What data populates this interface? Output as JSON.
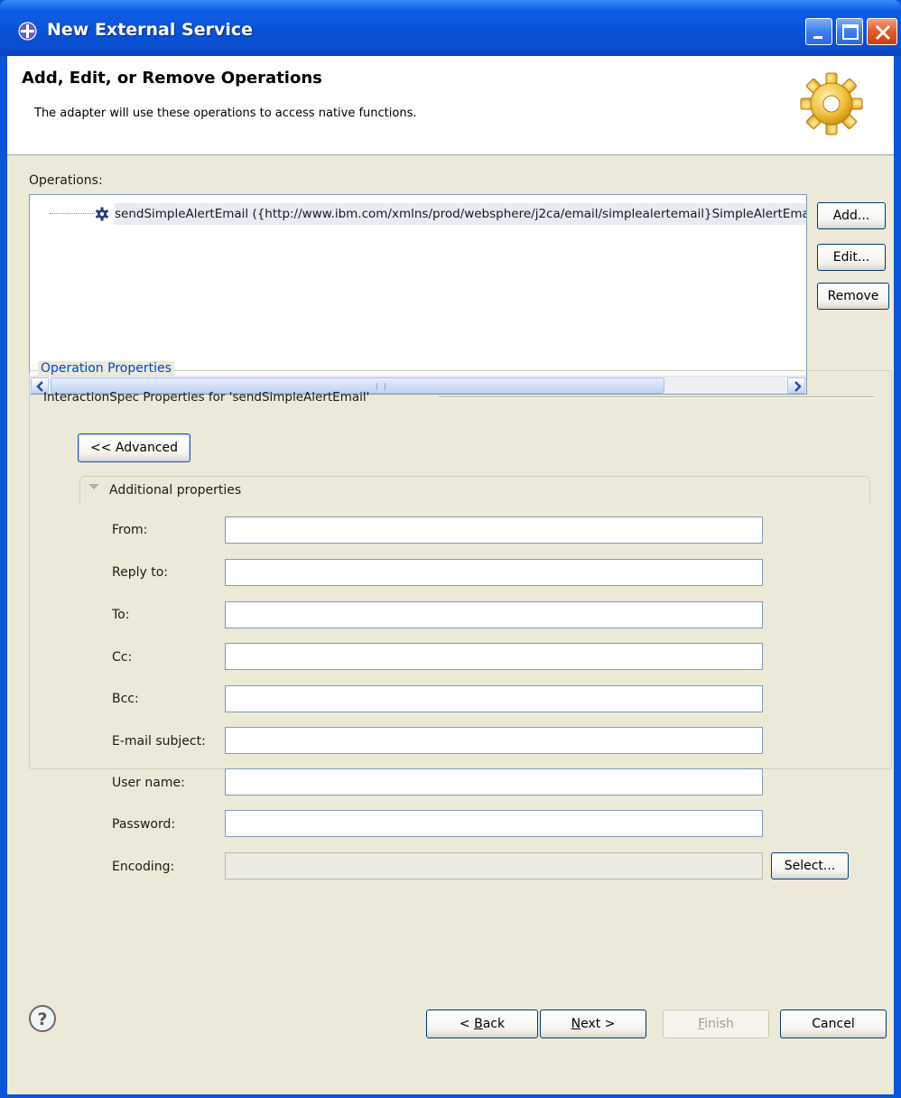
{
  "window": {
    "title": "New External Service"
  },
  "header": {
    "title": "Add, Edit, or Remove Operations",
    "description": "The adapter will use these operations to access native functions."
  },
  "operations": {
    "label": "Operations:",
    "items": [
      {
        "text": "sendSimpleAlertEmail ({http://www.ibm.com/xmlns/prod/websphere/j2ca/email/simplealertemail}SimpleAlertEmail)"
      }
    ],
    "buttons": {
      "add": "Add...",
      "edit": "Edit...",
      "remove": "Remove"
    }
  },
  "operation_properties": {
    "legend": "Operation Properties",
    "interaction_spec_label": "InteractionSpec Properties for 'sendSimpleAlertEmail'",
    "advanced_button": "<< Advanced",
    "additional_label": "Additional properties",
    "fields": [
      {
        "label": "From:",
        "value": ""
      },
      {
        "label": "Reply to:",
        "value": ""
      },
      {
        "label": "To:",
        "value": ""
      },
      {
        "label": "Cc:",
        "value": ""
      },
      {
        "label": "Bcc:",
        "value": ""
      },
      {
        "label": "E-mail subject:",
        "value": ""
      },
      {
        "label": "User name:",
        "value": ""
      },
      {
        "label": "Password:",
        "value": ""
      },
      {
        "label": "Encoding:",
        "value": "",
        "disabled": true
      }
    ],
    "select_button": "Select..."
  },
  "footer": {
    "help_icon": "question-circle-icon",
    "back_mnemonic": "B",
    "back_rest": "ack",
    "back_prefix": "< ",
    "next_mnemonic": "N",
    "next_rest": "ext >",
    "finish_mnemonic": "F",
    "finish_rest": "inish",
    "cancel": "Cancel"
  },
  "colors": {
    "titlebar": "#0a52d6",
    "dialog_bg": "#ece9d8",
    "legend_text": "#0046d5"
  }
}
